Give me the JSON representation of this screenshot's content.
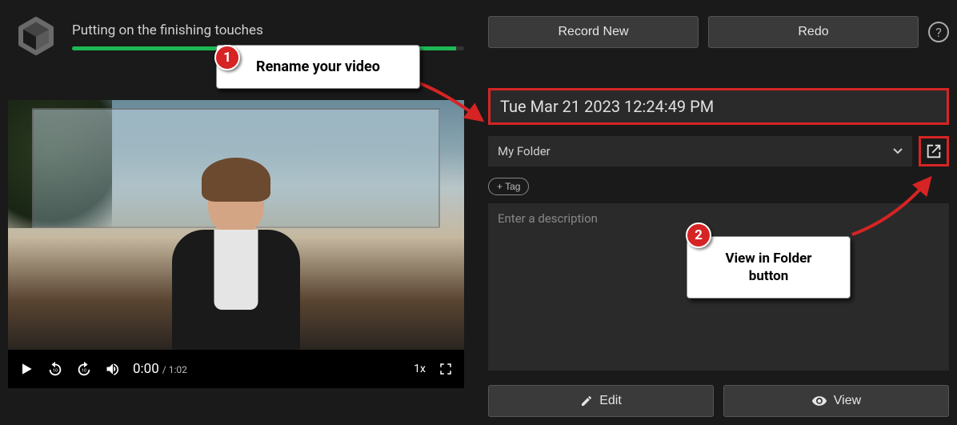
{
  "header": {
    "progress_text": "Putting on the finishing touches",
    "record_new": "Record New",
    "redo": "Redo"
  },
  "video": {
    "current_time": "0:00",
    "total_time": "1:02",
    "speed": "1x"
  },
  "form": {
    "title": "Tue Mar 21 2023 12:24:49 PM",
    "folder": "My Folder",
    "tag_button": "+ Tag",
    "description_placeholder": "Enter a description"
  },
  "actions": {
    "edit": "Edit",
    "view": "View"
  },
  "callouts": {
    "c1": {
      "num": "1",
      "text": "Rename your video"
    },
    "c2": {
      "num": "2",
      "text": "View in Folder button"
    }
  }
}
